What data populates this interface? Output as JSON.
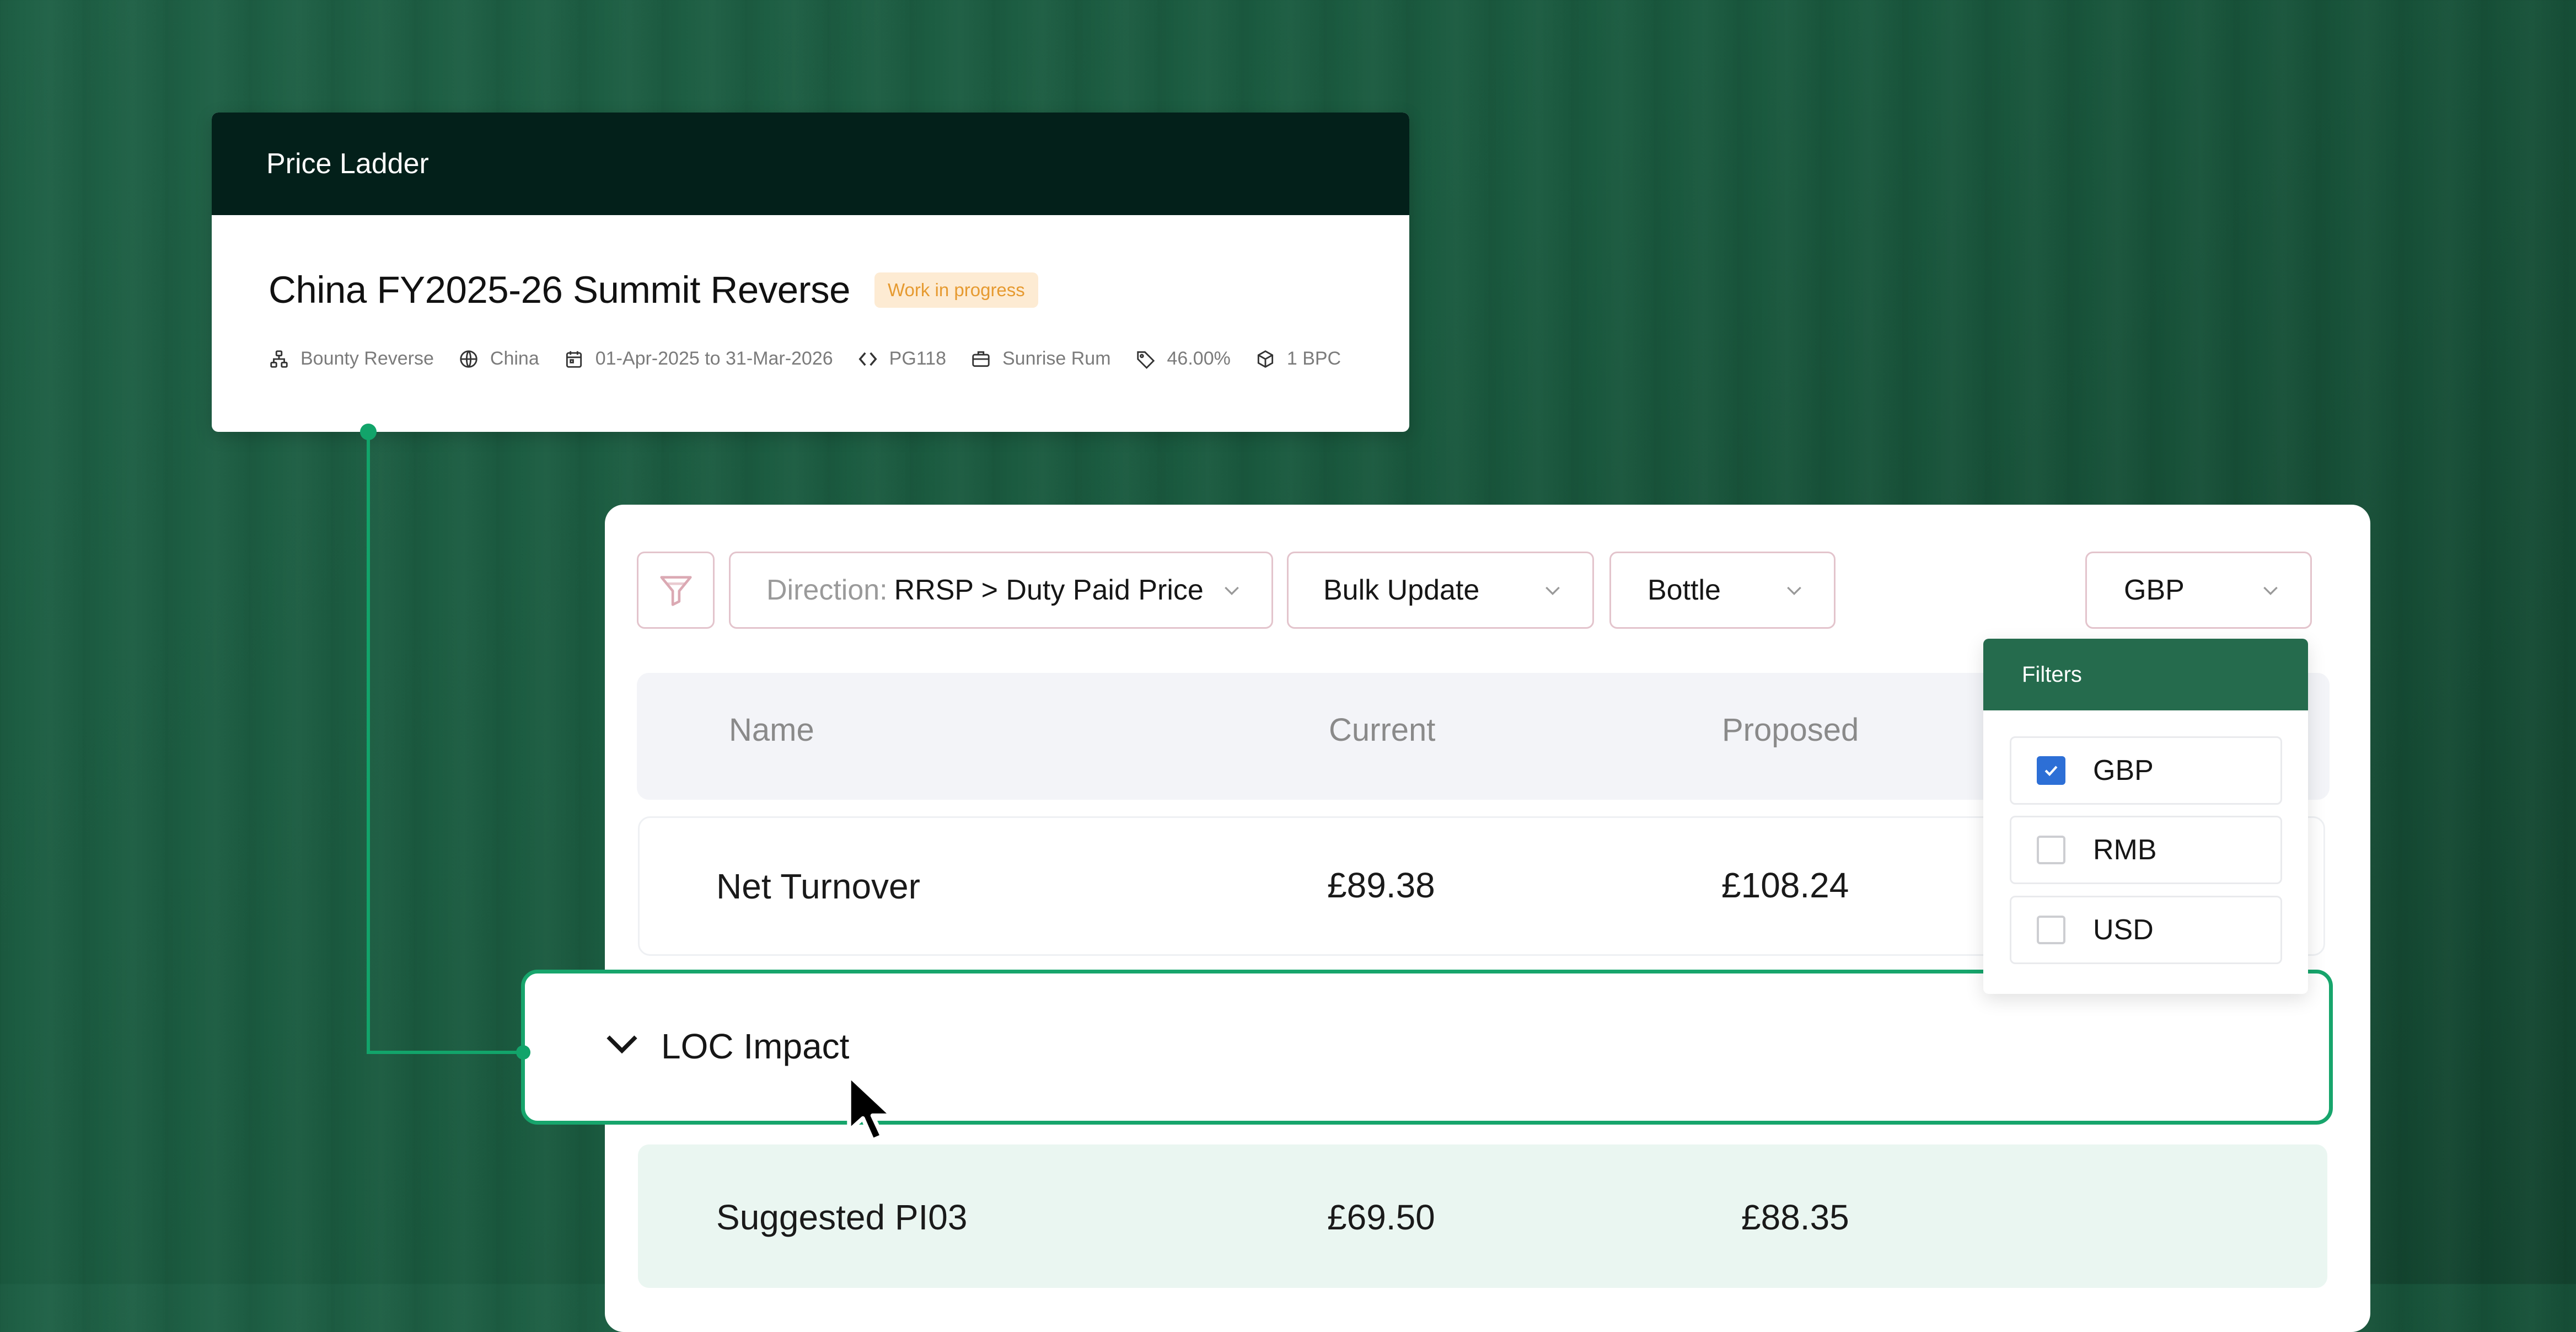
{
  "price_ladder": {
    "header_title": "Price Ladder",
    "title": "China FY2025-26 Summit Reverse",
    "status_badge": "Work in progress",
    "meta": [
      {
        "icon": "hierarchy-icon",
        "text": "Bounty Reverse"
      },
      {
        "icon": "globe-icon",
        "text": "China"
      },
      {
        "icon": "calendar-icon",
        "text": "01-Apr-2025 to 31-Mar-2026"
      },
      {
        "icon": "code-icon",
        "text": "PG118"
      },
      {
        "icon": "briefcase-icon",
        "text": "Sunrise Rum"
      },
      {
        "icon": "tag-icon",
        "text": "46.00%"
      },
      {
        "icon": "box-icon",
        "text": "1 BPC"
      }
    ]
  },
  "toolbar": {
    "direction_label": "Direction:",
    "direction_value": "RRSP > Duty Paid Price",
    "bulk_update": "Bulk Update",
    "unit": "Bottle",
    "currency": "GBP"
  },
  "table": {
    "columns": [
      "Name",
      "Current",
      "Proposed"
    ],
    "rows": [
      {
        "name": "Net Turnover",
        "current": "£89.38",
        "proposed": "£108.24"
      },
      {
        "name": "Suggested PI03",
        "current": "£69.50",
        "proposed": "£88.35"
      }
    ],
    "group": {
      "label": "LOC Impact",
      "expanded": true
    }
  },
  "filters": {
    "title": "Filters",
    "options": [
      {
        "label": "GBP",
        "checked": true
      },
      {
        "label": "RMB",
        "checked": false
      },
      {
        "label": "USD",
        "checked": false
      }
    ]
  },
  "colors": {
    "accent": "#17a56c",
    "header_dark": "#03201a",
    "filter_header": "#256b4d",
    "checkbox_checked": "#2d6fd6",
    "badge_bg": "#fdebd3",
    "badge_text": "#e69a30"
  }
}
